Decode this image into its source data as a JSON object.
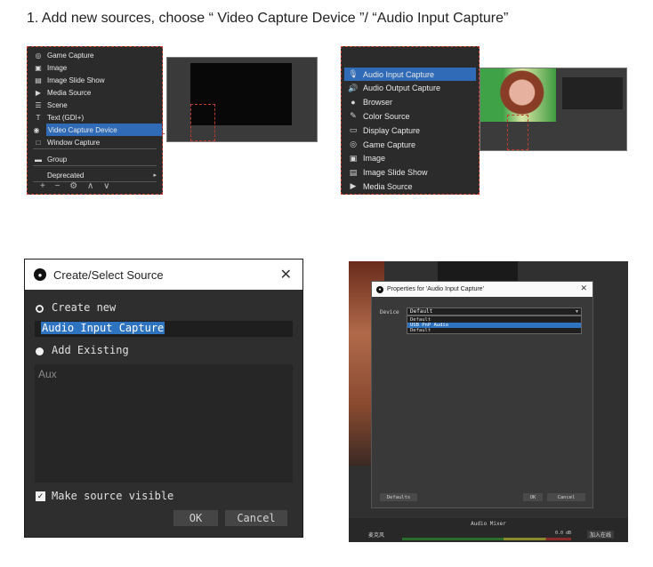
{
  "heading": "1. Add new sources, choose “ Video Capture Device ”/ “Audio Input Capture”",
  "panel1": {
    "items": [
      {
        "icon": "◎",
        "label": "Game Capture"
      },
      {
        "icon": "▣",
        "label": "Image"
      },
      {
        "icon": "▤",
        "label": "Image Slide Show"
      },
      {
        "icon": "▶",
        "label": "Media Source"
      },
      {
        "icon": "☰",
        "label": "Scene"
      },
      {
        "icon": "T",
        "label": "Text (GDI+)"
      },
      {
        "icon": "◉",
        "label": "Video Capture Device"
      },
      {
        "icon": "□",
        "label": "Window Capture"
      },
      {
        "icon": "▬",
        "label": "Group"
      },
      {
        "icon": "",
        "label": "Deprecated"
      }
    ],
    "selected_label": "Video Capture Device",
    "bottom_controls": "+ − ⚙ ∧ ∨"
  },
  "panel2": {
    "items": [
      {
        "icon": "🎙",
        "label": "Audio Input Capture"
      },
      {
        "icon": "🔊",
        "label": "Audio Output Capture"
      },
      {
        "icon": "●",
        "label": "Browser"
      },
      {
        "icon": "✎",
        "label": "Color Source"
      },
      {
        "icon": "▭",
        "label": "Display Capture"
      },
      {
        "icon": "◎",
        "label": "Game Capture"
      },
      {
        "icon": "▣",
        "label": "Image"
      },
      {
        "icon": "▤",
        "label": "Image Slide Show"
      },
      {
        "icon": "▶",
        "label": "Media Source"
      }
    ],
    "selected_label": "Audio Input Capture"
  },
  "dialog": {
    "title": "Create/Select Source",
    "close": "✕",
    "create_new_label": "Create new",
    "name_value": "Audio Input Capture",
    "add_existing_label": "Add Existing",
    "existing_items": [
      "Aux"
    ],
    "make_visible_label": "Make source visible",
    "ok_label": "OK",
    "cancel_label": "Cancel"
  },
  "properties": {
    "title": "Properties for 'Audio Input Capture'",
    "close": "✕",
    "device_label": "Device",
    "device_value": "Default",
    "options": [
      "Default",
      "USB PnP Audio",
      "Default"
    ],
    "selected_option": "USB PnP Audio",
    "defaults_label": "Defaults",
    "ok_label": "OK",
    "cancel_label": "Cancel",
    "mixer_title": "Audio Mixer",
    "mixer_source": "麦克风",
    "mixer_value": "0.0 dB",
    "mixer_right": "加入在线"
  },
  "colors": {
    "selection": "#2f6bb6",
    "dialog_bg": "#2e2e2e",
    "annotation": "#c23a2a"
  }
}
